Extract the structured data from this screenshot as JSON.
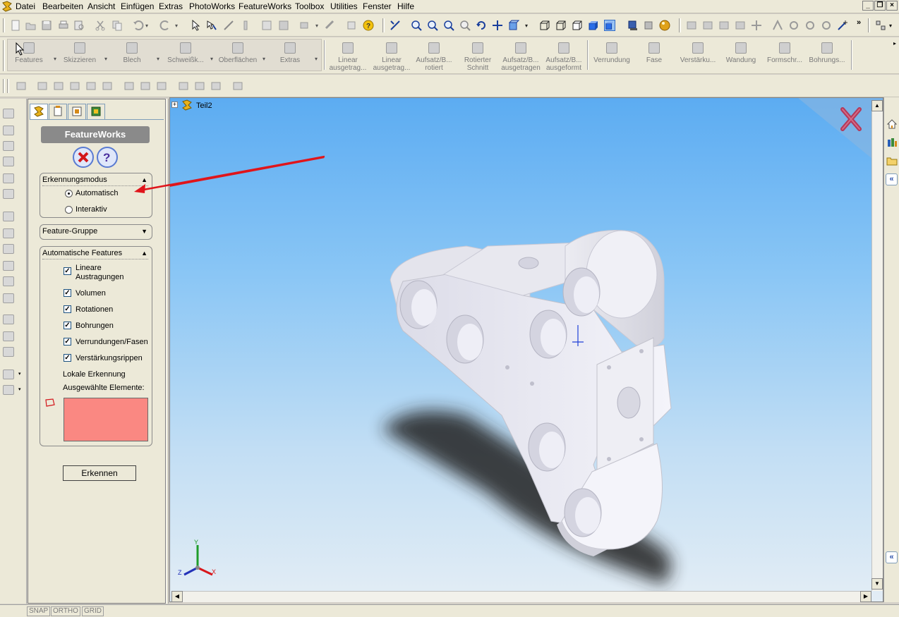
{
  "menu": {
    "items": [
      "Datei",
      "Bearbeiten",
      "Ansicht",
      "Einfügen",
      "Extras",
      "PhotoWorks",
      "FeatureWorks",
      "Toolbox",
      "Utilities",
      "Fenster",
      "Hilfe"
    ],
    "mnemonics": [
      "D",
      "B",
      "A",
      "E",
      "x",
      "P",
      "F",
      "T",
      "U",
      "F",
      "H"
    ]
  },
  "command_manager": {
    "tabs": [
      {
        "label": "Features"
      },
      {
        "label": "Skizzieren"
      },
      {
        "label": "Blech"
      },
      {
        "label": "Schweißk..."
      },
      {
        "label": "Oberflächen"
      },
      {
        "label": "Extras"
      }
    ],
    "commands": [
      {
        "line1": "Linear",
        "line2": "ausgetrag..."
      },
      {
        "line1": "Linear",
        "line2": "ausgetrag..."
      },
      {
        "line1": "Aufsatz/B...",
        "line2": "rotiert"
      },
      {
        "line1": "Rotierter",
        "line2": "Schnitt"
      },
      {
        "line1": "Aufsatz/B...",
        "line2": "ausgetragen"
      },
      {
        "line1": "Aufsatz/B...",
        "line2": "ausgeformt"
      },
      {
        "line1": "Verrundung",
        "line2": ""
      },
      {
        "line1": "Fase",
        "line2": ""
      },
      {
        "line1": "Verstärku...",
        "line2": ""
      },
      {
        "line1": "Wandung",
        "line2": ""
      },
      {
        "line1": "Formschr...",
        "line2": ""
      },
      {
        "line1": "Bohrungs...",
        "line2": ""
      }
    ]
  },
  "property_manager": {
    "title": "FeatureWorks",
    "recognition_mode": {
      "header": "Erkennungsmodus",
      "options": [
        {
          "label": "Automatisch",
          "mnemonic": "A",
          "selected": true
        },
        {
          "label": "Interaktiv",
          "mnemonic": "I",
          "selected": false
        }
      ]
    },
    "feature_group": {
      "header": "Feature-Gruppe"
    },
    "automatic_features": {
      "header": "Automatische Features",
      "items": [
        {
          "label": "Lineare",
          "label2": "Austragungen",
          "checked": true
        },
        {
          "label": "Volumen",
          "checked": true
        },
        {
          "label": "Rotationen",
          "checked": true
        },
        {
          "label": "Bohrungen",
          "checked": true
        },
        {
          "label": "Verrundungen/Fasen",
          "checked": true
        },
        {
          "label": "Verstärkungsrippen",
          "checked": true
        }
      ],
      "local_recognition": "Lokale Erkennung",
      "selected_elements": "Ausgewählte Elemente:",
      "selection_color": "#fa8882"
    },
    "recognize_button": "Erkennen"
  },
  "feature_tree": {
    "root": "Teil2"
  },
  "triad": {
    "x": "X",
    "y": "Y",
    "z": "Z"
  },
  "status_bar": [
    "SNAP",
    "ORTHO",
    "GRID"
  ],
  "colors": {
    "viewport_top": "#5cacf2",
    "viewport_bottom": "#e3edf5",
    "annotation_arrow": "#e0151b",
    "close_x": "#b0284a"
  }
}
